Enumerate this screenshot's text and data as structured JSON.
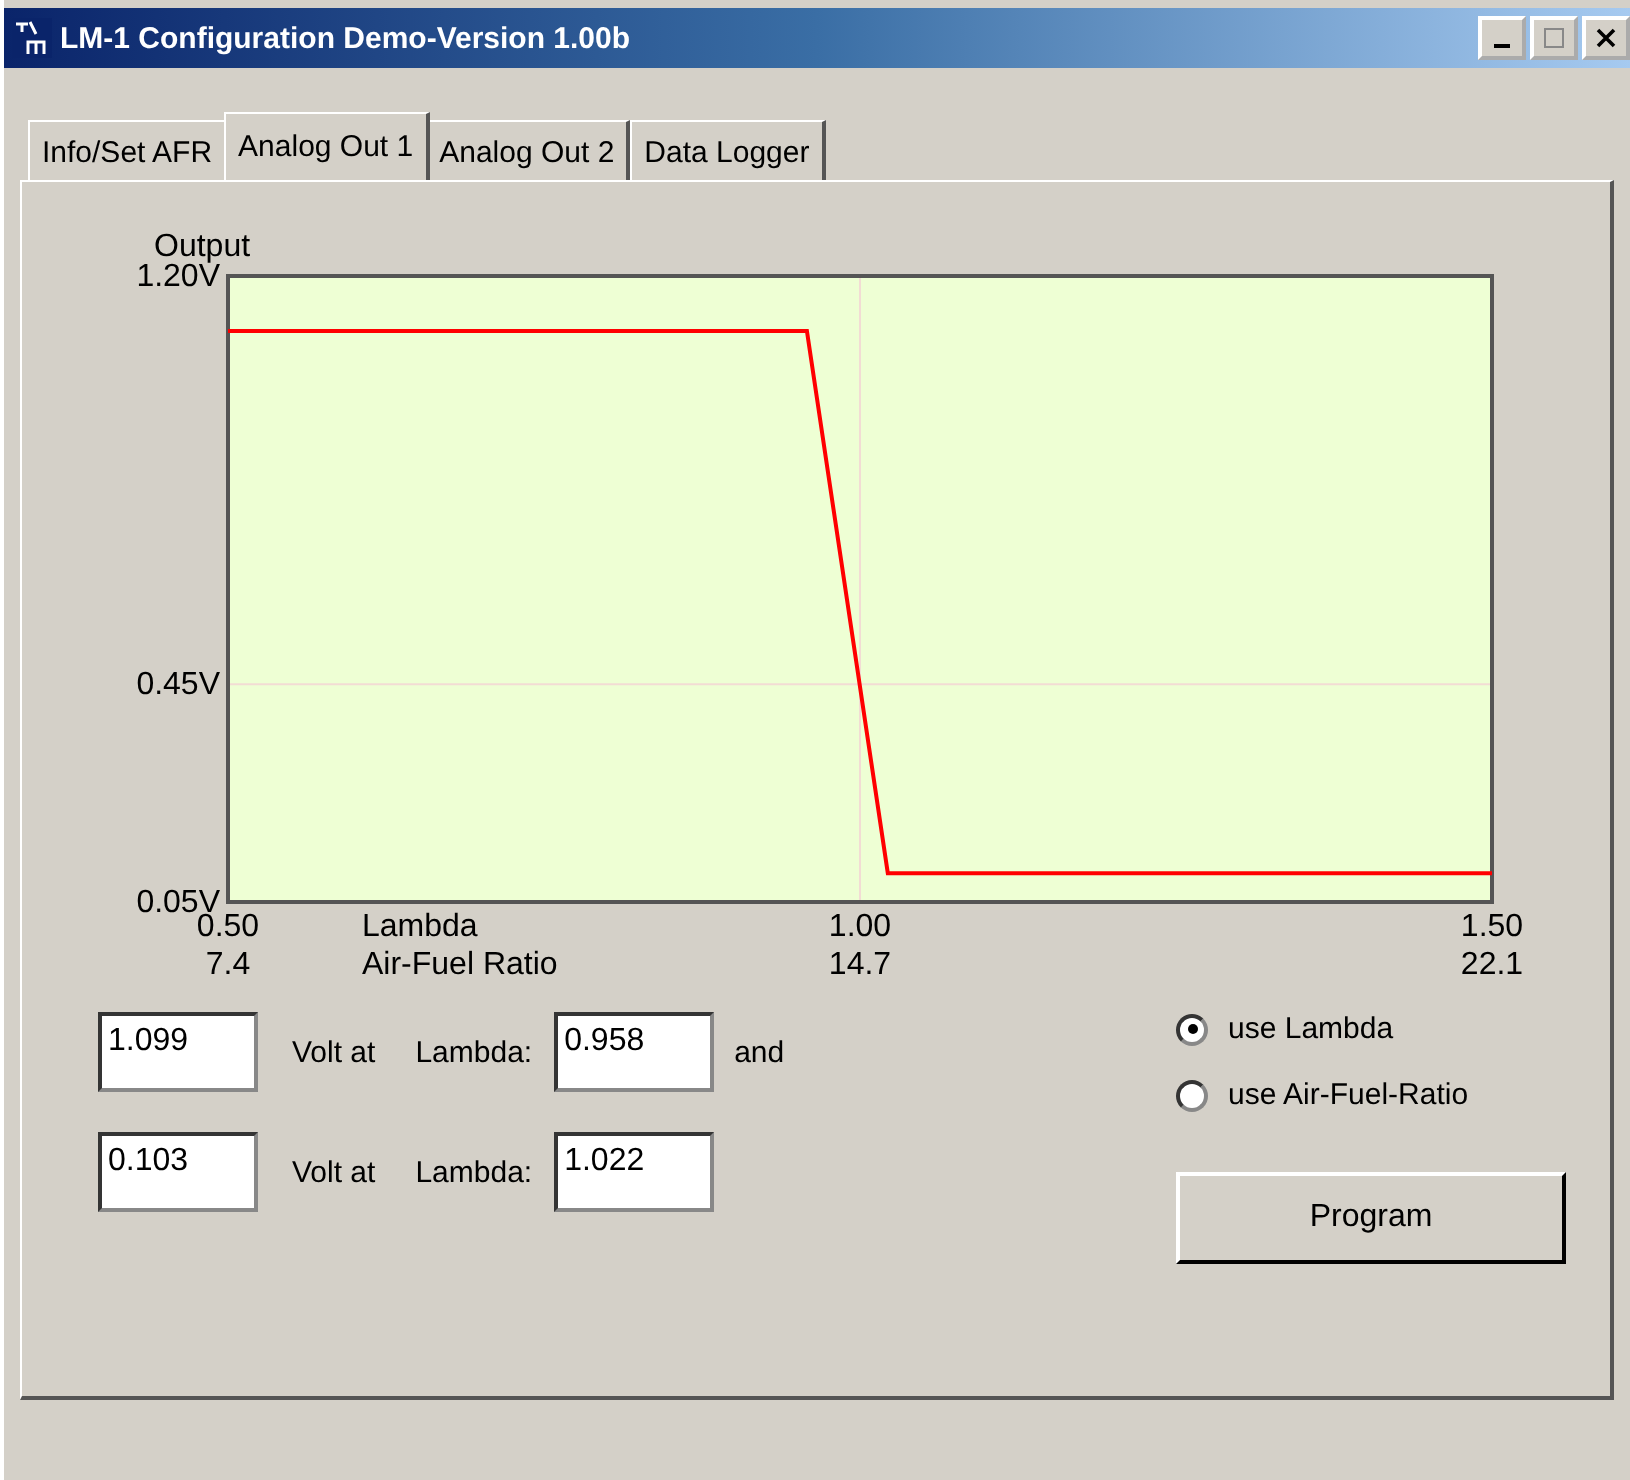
{
  "window": {
    "title": "LM-1 Configuration Demo-Version 1.00b"
  },
  "tabs": [
    {
      "label": "Info/Set AFR",
      "selected": false
    },
    {
      "label": "Analog Out 1",
      "selected": true
    },
    {
      "label": "Analog Out 2",
      "selected": false
    },
    {
      "label": "Data Logger",
      "selected": false
    }
  ],
  "chart": {
    "chart_data": {
      "type": "line",
      "ylabel": "Output",
      "xlabel": "Lambda",
      "x": [
        0.5,
        0.958,
        1.022,
        1.5
      ],
      "series": [
        {
          "color": "#ff0000",
          "values": [
            1.099,
            1.099,
            0.103,
            0.103
          ]
        }
      ],
      "xlim": [
        0.5,
        1.5
      ],
      "ylim": [
        0.05,
        1.2
      ],
      "xticks": [
        {
          "value": 0.5,
          "label": "0.50"
        },
        {
          "value": 1.0,
          "label": "1.00"
        },
        {
          "value": 1.5,
          "label": "1.50"
        }
      ],
      "yticks": [
        {
          "value": 1.2,
          "label": "1.20V"
        },
        {
          "value": 0.45,
          "label": "0.45V"
        },
        {
          "value": 0.05,
          "label": "0.05V"
        }
      ]
    },
    "secondary_axis": {
      "label": "Air-Fuel Ratio",
      "ticks": [
        "7.4",
        "14.7",
        "22.1"
      ]
    }
  },
  "rows": [
    {
      "volt": "1.099",
      "volt_label": "Volt at",
      "lambda_label": "Lambda:",
      "lambda": "0.958",
      "suffix": "and"
    },
    {
      "volt": "0.103",
      "volt_label": "Volt at",
      "lambda_label": "Lambda:",
      "lambda": "1.022"
    }
  ],
  "options": [
    {
      "label": "use Lambda",
      "selected": true
    },
    {
      "label": "use Air-Fuel-Ratio",
      "selected": false
    }
  ],
  "program_button": "Program"
}
